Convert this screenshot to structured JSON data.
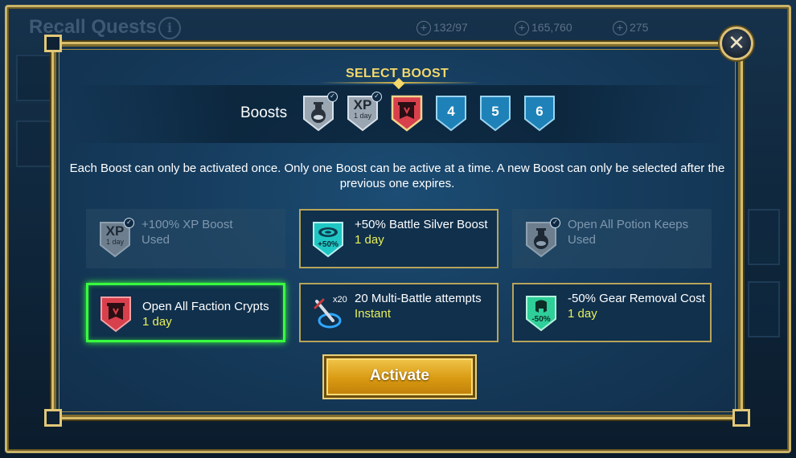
{
  "background": {
    "screen_title": "Recall Quests",
    "info_icon": "i",
    "resources": [
      {
        "value": "132/97",
        "icon": "lightning-icon"
      },
      {
        "value": "165,760",
        "icon": "silver-icon"
      },
      {
        "value": "275",
        "icon": "gem-icon"
      }
    ]
  },
  "modal": {
    "title": "SELECT BOOST",
    "boosts_label": "Boosts",
    "boost_slots": [
      {
        "label": "",
        "type": "potion",
        "used": true
      },
      {
        "label": "XP",
        "sub": "1 day",
        "type": "xp",
        "used": true
      },
      {
        "label": "",
        "type": "faction",
        "selected": true
      },
      {
        "label": "4",
        "type": "empty"
      },
      {
        "label": "5",
        "type": "empty"
      },
      {
        "label": "6",
        "type": "empty"
      }
    ],
    "description": "Each Boost can only be activated once. Only one Boost can be active at a time. A new Boost can only be selected after the previous one expires.",
    "options": [
      {
        "title": "+100% XP Boost",
        "duration": "Used",
        "state": "used",
        "icon_text": "XP",
        "icon_sub": "1 day"
      },
      {
        "title": "+50% Battle Silver Boost",
        "duration": "1 day",
        "state": "available",
        "icon_text": "+50%"
      },
      {
        "title": "Open All Potion Keeps",
        "duration": "Used",
        "state": "used"
      },
      {
        "title": "Open All Faction Crypts",
        "duration": "1 day",
        "state": "selected"
      },
      {
        "title": "20 Multi-Battle attempts",
        "duration": "Instant",
        "state": "available",
        "icon_text": "x20"
      },
      {
        "title": "-50% Gear Removal Cost",
        "duration": "1 day",
        "state": "available",
        "icon_text": "-50%"
      }
    ],
    "activate_label": "Activate",
    "close_symbol": "✕"
  },
  "colors": {
    "accent_gold": "#d6bc6b",
    "duration_yellow": "#e8f05a",
    "selected_green": "#39ff3f",
    "slot_blue": "#1e82b8"
  }
}
